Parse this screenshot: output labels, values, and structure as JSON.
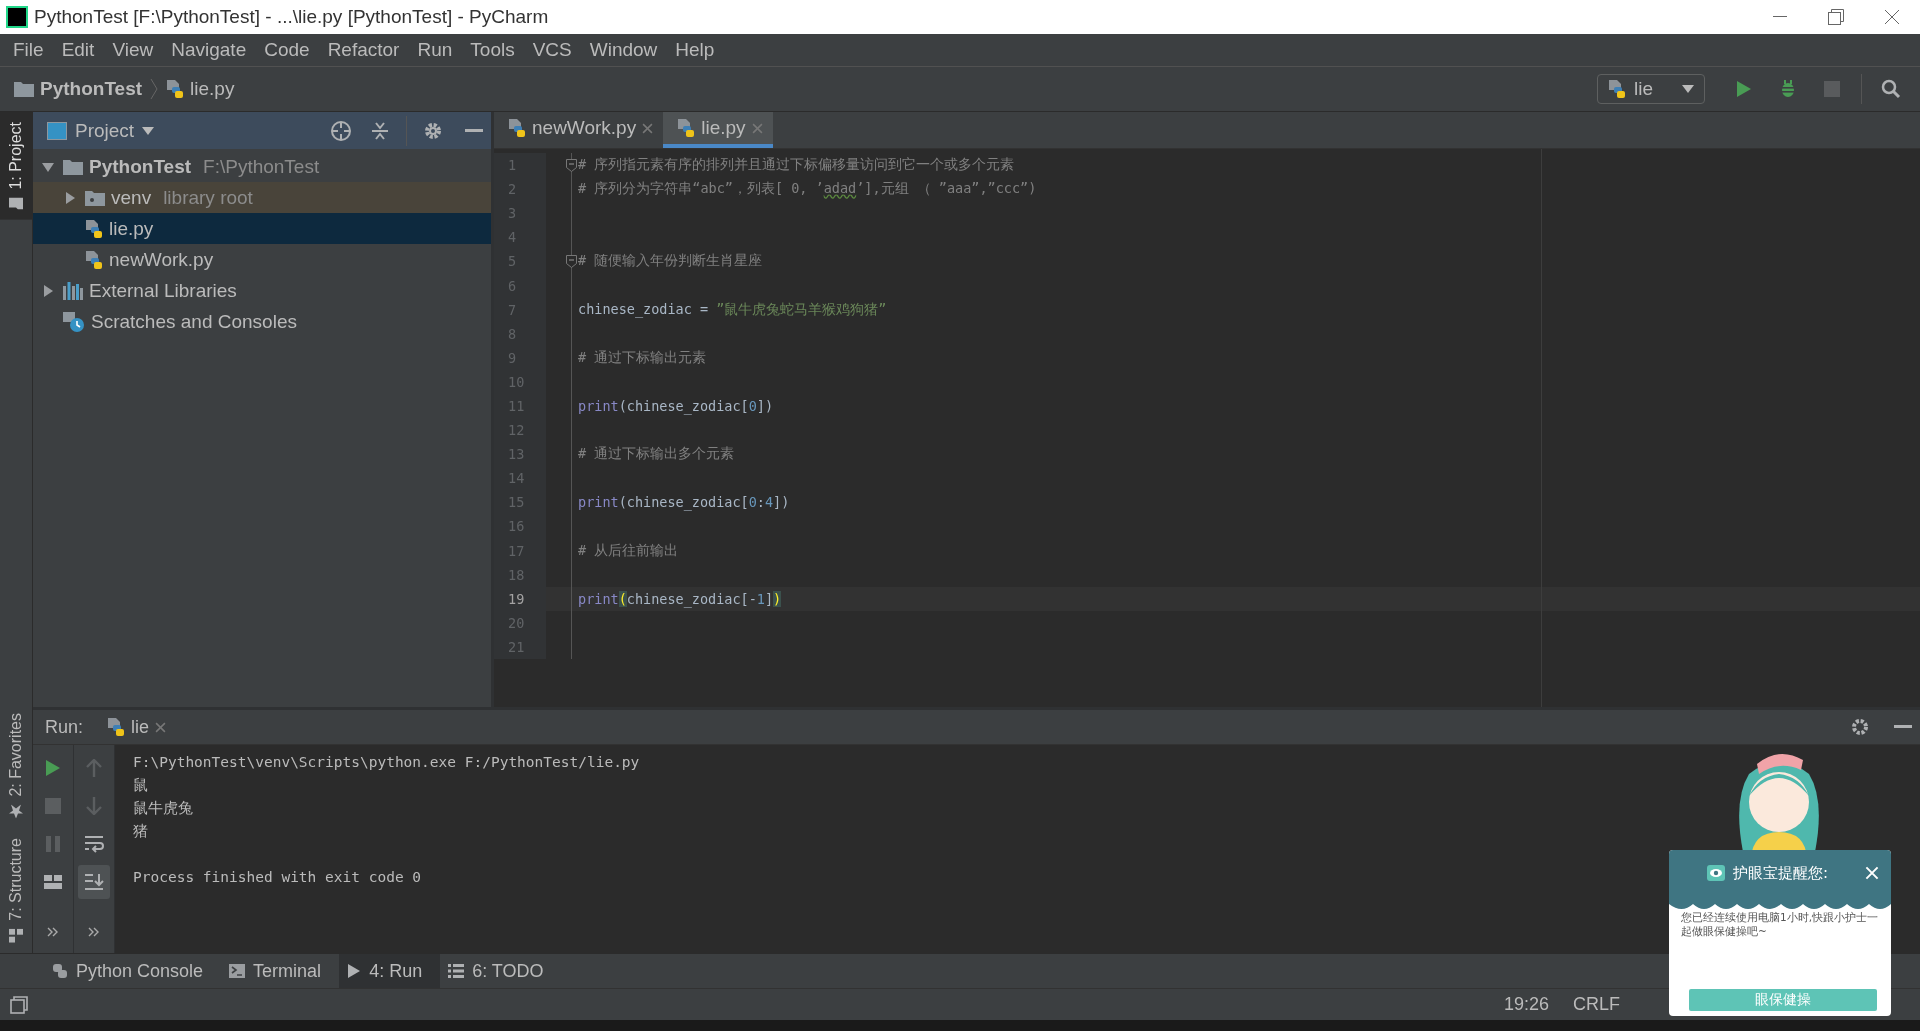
{
  "window": {
    "title": "PythonTest [F:\\PythonTest] - ...\\lie.py [PythonTest] - PyCharm"
  },
  "menu": [
    "File",
    "Edit",
    "View",
    "Navigate",
    "Code",
    "Refactor",
    "Run",
    "Tools",
    "VCS",
    "Window",
    "Help"
  ],
  "breadcrumb": [
    {
      "label": "PythonTest",
      "kind": "project"
    },
    {
      "label": "lie.py",
      "kind": "file"
    }
  ],
  "run_config": {
    "label": "lie"
  },
  "nav_actions": [
    {
      "kind": "run",
      "disabled": false
    },
    {
      "kind": "debug",
      "disabled": false
    },
    {
      "kind": "stop",
      "disabled": true
    },
    {
      "kind": "search",
      "disabled": false
    }
  ],
  "left_stripe": [
    {
      "label": "1: Project",
      "kind": "project",
      "selected": true
    },
    {
      "label": "2: Favorites",
      "kind": "favorites",
      "selected": false
    },
    {
      "label": "7: Structure",
      "kind": "structure",
      "selected": false
    }
  ],
  "project_panel": {
    "title": "Project",
    "tree": [
      {
        "label": "PythonTest",
        "hint": "F:\\PythonTest",
        "kind": "folder",
        "expanded": true,
        "selected": false,
        "children": [
          {
            "label": "venv",
            "hint": "library root",
            "kind": "library",
            "expanded": false,
            "selected": false
          },
          {
            "label": "lie.py",
            "kind": "file",
            "selected": true
          },
          {
            "label": "newWork.py",
            "kind": "file",
            "selected": false
          }
        ]
      },
      {
        "label": "External Libraries",
        "kind": "libraries",
        "expanded": false,
        "selected": false
      },
      {
        "label": "Scratches and Consoles",
        "kind": "scratches",
        "selected": false
      }
    ]
  },
  "editor": {
    "tabs": [
      {
        "label": "newWork.py",
        "selected": false
      },
      {
        "label": "lie.py",
        "selected": true
      }
    ],
    "lines": [
      {
        "number": "1",
        "fold": true,
        "current": false,
        "tokens": [
          {
            "text": "# 序列指元素有序的排列并且通过下标偏移量访问到它一个或多个元素",
            "kind": "comment"
          }
        ]
      },
      {
        "number": "2",
        "fold": false,
        "current": false,
        "tokens": [
          {
            "text": "# 序列分为字符串“abc”，列表[ 0, ’",
            "kind": "comment"
          },
          {
            "text": "adad",
            "kind": "typo"
          },
          {
            "text": "’],元组 （ ”aaa”,”ccc”)",
            "kind": "comment"
          }
        ]
      },
      {
        "number": "3",
        "fold": false,
        "current": false
      },
      {
        "number": "4",
        "fold": false,
        "current": false
      },
      {
        "number": "5",
        "fold": true,
        "current": false,
        "tokens": [
          {
            "text": "# 随便输入年份判断生肖星座",
            "kind": "comment"
          }
        ]
      },
      {
        "number": "6",
        "fold": false,
        "current": false
      },
      {
        "number": "7",
        "fold": false,
        "current": false,
        "tokens": [
          {
            "text": "chinese_zodiac = ",
            "kind": "plain"
          },
          {
            "text": "”鼠牛虎兔蛇马羊猴鸡狗猪”",
            "kind": "string"
          }
        ]
      },
      {
        "number": "8",
        "fold": false,
        "current": false
      },
      {
        "number": "9",
        "fold": false,
        "current": false,
        "tokens": [
          {
            "text": "# 通过下标输出元素",
            "kind": "comment"
          }
        ]
      },
      {
        "number": "10",
        "fold": false,
        "current": false
      },
      {
        "number": "11",
        "fold": false,
        "current": false,
        "tokens": [
          {
            "text": "print",
            "kind": "keyword"
          },
          {
            "text": "(chinese_zodiac[",
            "kind": "plain"
          },
          {
            "text": "0",
            "kind": "number"
          },
          {
            "text": "])",
            "kind": "plain"
          }
        ]
      },
      {
        "number": "12",
        "fold": false,
        "current": false
      },
      {
        "number": "13",
        "fold": false,
        "current": false,
        "tokens": [
          {
            "text": "# 通过下标输出多个元素",
            "kind": "comment"
          }
        ]
      },
      {
        "number": "14",
        "fold": false,
        "current": false
      },
      {
        "number": "15",
        "fold": false,
        "current": false,
        "tokens": [
          {
            "text": "print",
            "kind": "keyword"
          },
          {
            "text": "(chinese_zodiac[",
            "kind": "plain"
          },
          {
            "text": "0",
            "kind": "number"
          },
          {
            "text": ":",
            "kind": "plain"
          },
          {
            "text": "4",
            "kind": "number"
          },
          {
            "text": "])",
            "kind": "plain"
          }
        ]
      },
      {
        "number": "16",
        "fold": false,
        "current": false
      },
      {
        "number": "17",
        "fold": false,
        "current": false,
        "tokens": [
          {
            "text": "# 从后往前输出",
            "kind": "comment"
          }
        ]
      },
      {
        "number": "18",
        "fold": false,
        "current": false
      },
      {
        "number": "19",
        "fold": false,
        "current": true,
        "tokens": [
          {
            "text": "print",
            "kind": "keyword"
          },
          {
            "text": "(",
            "kind": "match"
          },
          {
            "text": "chinese_zodiac[-",
            "kind": "plain"
          },
          {
            "text": "1",
            "kind": "number"
          },
          {
            "text": "]",
            "kind": "plain"
          },
          {
            "text": ")",
            "kind": "match"
          }
        ]
      },
      {
        "number": "20",
        "fold": false,
        "current": false
      },
      {
        "number": "21",
        "fold": false,
        "current": false
      }
    ]
  },
  "run_panel": {
    "title": "Run:",
    "tab": "lie",
    "toolbar_left": [
      {
        "kind": "rerun",
        "disabled": false
      },
      {
        "kind": "stop",
        "disabled": true
      },
      {
        "kind": "pause",
        "disabled": true
      },
      {
        "kind": "layout",
        "disabled": false
      },
      {
        "kind": "more"
      }
    ],
    "toolbar_right": [
      {
        "kind": "up",
        "disabled": true,
        "selected": false
      },
      {
        "kind": "down",
        "disabled": true,
        "selected": false
      },
      {
        "kind": "wrap",
        "disabled": false,
        "selected": false
      },
      {
        "kind": "scroll-end",
        "disabled": false,
        "selected": true
      },
      {
        "kind": "more",
        "selected": false
      }
    ],
    "output": [
      {
        "text": "F:\\PythonTest\\venv\\Scripts\\python.exe F:/PythonTest/lie.py",
        "kind": "command"
      },
      {
        "text": "鼠",
        "kind": "stdout"
      },
      {
        "text": "鼠牛虎兔",
        "kind": "stdout"
      },
      {
        "text": "猪",
        "kind": "stdout"
      },
      {
        "text": "Process finished with exit code 0",
        "kind": "exit"
      }
    ]
  },
  "tool_tabs": [
    {
      "label": "Python Console",
      "kind": "console",
      "selected": false
    },
    {
      "label": "Terminal",
      "kind": "terminal",
      "selected": false
    },
    {
      "label": "4: Run",
      "kind": "run",
      "selected": true
    },
    {
      "label": "6: TODO",
      "kind": "todo",
      "selected": false
    }
  ],
  "status_bar": {
    "position": "19:26",
    "line_separator": "CRLF"
  },
  "popup": {
    "title": "护眼宝提醒您:",
    "message": "您已经连续使用电脑1小时,快跟小护士一起做眼保健操吧~",
    "button": "眼保健操"
  }
}
